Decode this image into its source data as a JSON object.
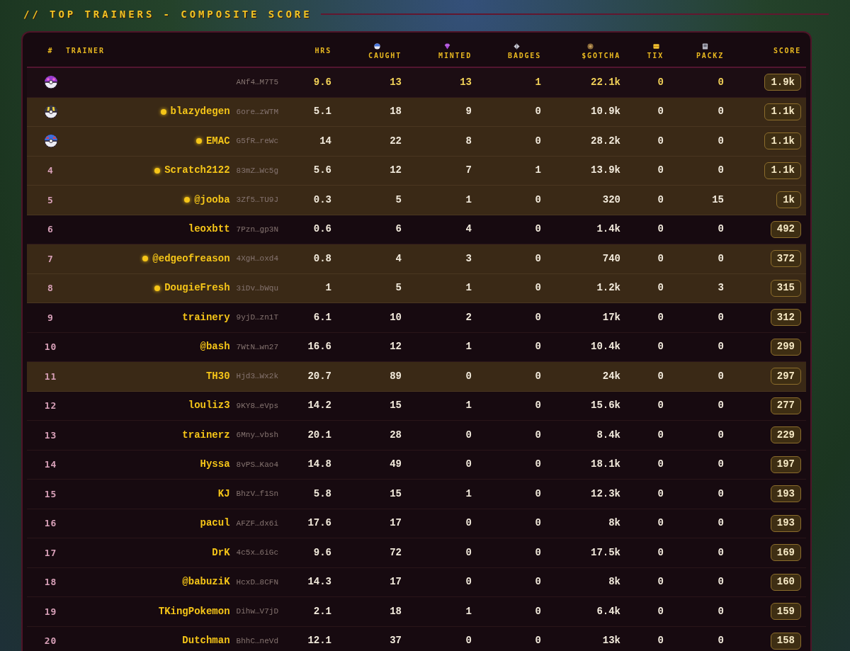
{
  "title": "// TOP TRAINERS - COMPOSITE SCORE",
  "table": {
    "columns": [
      {
        "label": "#",
        "has_icon": false
      },
      {
        "label": "TRAINER",
        "has_icon": false
      },
      {
        "label": "HRS",
        "has_icon": false
      },
      {
        "label": "CAUGHT",
        "has_icon": true
      },
      {
        "label": "MINTED",
        "has_icon": true
      },
      {
        "label": "BADGES",
        "has_icon": true
      },
      {
        "label": "$GOTCHA",
        "has_icon": true
      },
      {
        "label": "TIX",
        "has_icon": true
      },
      {
        "label": "PACKZ",
        "has_icon": true
      },
      {
        "label": "SCORE",
        "has_icon": false
      }
    ],
    "rows": [
      {
        "kind": "leader",
        "wallet": "ANf4…M7T5",
        "online": false,
        "highlighted": false,
        "stats": [
          "9.6",
          "13",
          "13",
          "1",
          "22.1k",
          "0",
          "0"
        ],
        "score": "1.9k"
      },
      {
        "kind": "podium",
        "name": "blazydegen",
        "wallet": "6ore…zWTM",
        "online": true,
        "highlighted": true,
        "stats": [
          "5.1",
          "18",
          "9",
          "0",
          "10.9k",
          "0",
          "0"
        ],
        "score": "1.1k"
      },
      {
        "kind": "podium",
        "name": "EMAC",
        "wallet": "G5fR…reWc",
        "online": true,
        "highlighted": true,
        "stats": [
          "14",
          "22",
          "8",
          "0",
          "28.2k",
          "0",
          "0"
        ],
        "score": "1.1k"
      },
      {
        "kind": "ranked",
        "rank": "4",
        "name": "Scratch2122",
        "wallet": "83mZ…Wc5g",
        "online": true,
        "highlighted": true,
        "stats": [
          "5.6",
          "12",
          "7",
          "1",
          "13.9k",
          "0",
          "0"
        ],
        "score": "1.1k"
      },
      {
        "kind": "ranked",
        "rank": "5",
        "name": "@jooba",
        "wallet": "3Zf5…TU9J",
        "online": true,
        "highlighted": true,
        "stats": [
          "0.3",
          "5",
          "1",
          "0",
          "320",
          "0",
          "15"
        ],
        "score": "1k"
      },
      {
        "kind": "ranked",
        "rank": "6",
        "name": "leoxbtt",
        "wallet": "7Pzn…gp3N",
        "online": false,
        "highlighted": false,
        "stats": [
          "0.6",
          "6",
          "4",
          "0",
          "1.4k",
          "0",
          "0"
        ],
        "score": "492"
      },
      {
        "kind": "ranked",
        "rank": "7",
        "name": "@edgeofreason",
        "wallet": "4XgH…oxd4",
        "online": true,
        "highlighted": true,
        "stats": [
          "0.8",
          "4",
          "3",
          "0",
          "740",
          "0",
          "0"
        ],
        "score": "372"
      },
      {
        "kind": "ranked",
        "rank": "8",
        "name": "DougieFresh",
        "wallet": "3iDv…bWqu",
        "online": true,
        "highlighted": true,
        "stats": [
          "1",
          "5",
          "1",
          "0",
          "1.2k",
          "0",
          "3"
        ],
        "score": "315"
      },
      {
        "kind": "ranked",
        "rank": "9",
        "name": "trainery",
        "wallet": "9yjD…zn1T",
        "online": false,
        "highlighted": false,
        "stats": [
          "6.1",
          "10",
          "2",
          "0",
          "17k",
          "0",
          "0"
        ],
        "score": "312"
      },
      {
        "kind": "ranked",
        "rank": "10",
        "name": "@bash",
        "wallet": "7WtN…wn27",
        "online": false,
        "highlighted": false,
        "stats": [
          "16.6",
          "12",
          "1",
          "0",
          "10.4k",
          "0",
          "0"
        ],
        "score": "299"
      },
      {
        "kind": "ranked",
        "rank": "11",
        "name": "TH30",
        "wallet": "Hjd3…Wx2k",
        "online": false,
        "highlighted": true,
        "stats": [
          "20.7",
          "89",
          "0",
          "0",
          "24k",
          "0",
          "0"
        ],
        "score": "297"
      },
      {
        "kind": "ranked",
        "rank": "12",
        "name": "louliz3",
        "wallet": "9KY8…eVps",
        "online": false,
        "highlighted": false,
        "stats": [
          "14.2",
          "15",
          "1",
          "0",
          "15.6k",
          "0",
          "0"
        ],
        "score": "277"
      },
      {
        "kind": "ranked",
        "rank": "13",
        "name": "trainerz",
        "wallet": "6Mny…vbsh",
        "online": false,
        "highlighted": false,
        "stats": [
          "20.1",
          "28",
          "0",
          "0",
          "8.4k",
          "0",
          "0"
        ],
        "score": "229"
      },
      {
        "kind": "ranked",
        "rank": "14",
        "name": "Hyssa",
        "wallet": "8vPS…Kao4",
        "online": false,
        "highlighted": false,
        "stats": [
          "14.8",
          "49",
          "0",
          "0",
          "18.1k",
          "0",
          "0"
        ],
        "score": "197"
      },
      {
        "kind": "ranked",
        "rank": "15",
        "name": "KJ",
        "wallet": "BhzV…f1Sn",
        "online": false,
        "highlighted": false,
        "stats": [
          "5.8",
          "15",
          "1",
          "0",
          "12.3k",
          "0",
          "0"
        ],
        "score": "193"
      },
      {
        "kind": "ranked",
        "rank": "16",
        "name": "pacul",
        "wallet": "AFZF…dx6i",
        "online": false,
        "highlighted": false,
        "stats": [
          "17.6",
          "17",
          "0",
          "0",
          "8k",
          "0",
          "0"
        ],
        "score": "193"
      },
      {
        "kind": "ranked",
        "rank": "17",
        "name": "DrK",
        "wallet": "4c5x…6iGc",
        "online": false,
        "highlighted": false,
        "stats": [
          "9.6",
          "72",
          "0",
          "0",
          "17.5k",
          "0",
          "0"
        ],
        "score": "169"
      },
      {
        "kind": "ranked",
        "rank": "18",
        "name": "@babuziK",
        "wallet": "HcxD…8CFN",
        "online": false,
        "highlighted": false,
        "stats": [
          "14.3",
          "17",
          "0",
          "0",
          "8k",
          "0",
          "0"
        ],
        "score": "160"
      },
      {
        "kind": "ranked",
        "rank": "19",
        "name": "TKingPokemon",
        "wallet": "Dihw…V7jD",
        "online": false,
        "highlighted": false,
        "stats": [
          "2.1",
          "18",
          "1",
          "0",
          "6.4k",
          "0",
          "0"
        ],
        "score": "159"
      },
      {
        "kind": "ranked",
        "rank": "20",
        "name": "Dutchman",
        "wallet": "BhhC…neVd",
        "online": false,
        "highlighted": false,
        "stats": [
          "12.1",
          "37",
          "0",
          "0",
          "13k",
          "0",
          "0"
        ],
        "score": "158"
      }
    ]
  }
}
